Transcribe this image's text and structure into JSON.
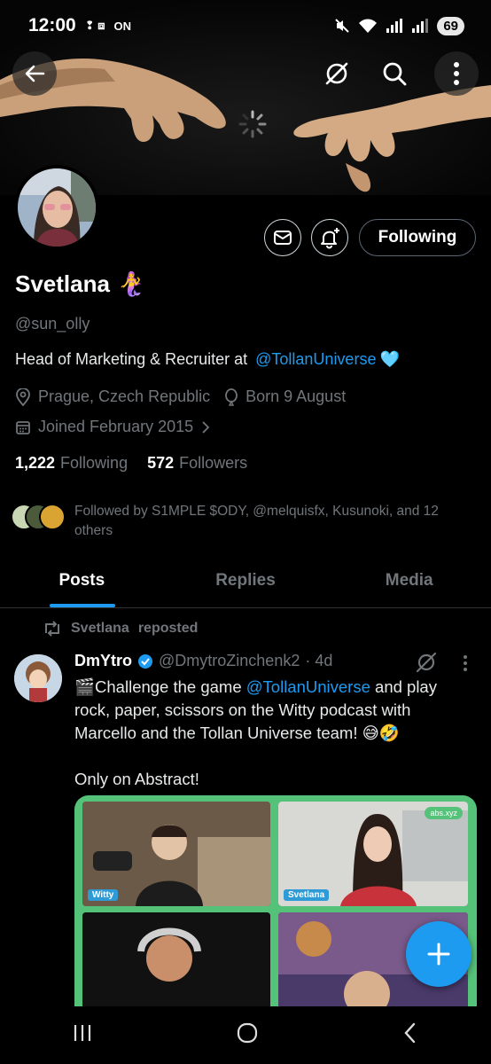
{
  "status_bar": {
    "time": "12:00",
    "indicators": "ON",
    "battery": "69"
  },
  "profile": {
    "name": "Svetlana",
    "name_emoji": "🧜‍♀️",
    "handle": "@sun_olly",
    "bio_prefix": "Head of Marketing & Recruiter at ",
    "bio_link": "@TollanUniverse",
    "bio_emoji": "🩵",
    "location": "Prague, Czech Republic",
    "birthday": "Born 9 August",
    "joined": "Joined February 2015",
    "following_count": "1,222",
    "following_label": "Following",
    "followers_count": "572",
    "followers_label": "Followers",
    "followed_by": "Followed by S1MPLE $ODY, @melquisfx, Kusunoki, and 12 others",
    "follow_button": "Following"
  },
  "tabs": [
    "Posts",
    "Replies",
    "Media"
  ],
  "post": {
    "repost_by": "Svetlana",
    "repost_label": "reposted",
    "author": "DmYtro",
    "author_handle": "@DmytroZinchenk2",
    "age": "· 4d",
    "text_lead": "🎬Challenge the game ",
    "text_link": "@TollanUniverse",
    "text_rest": " and play rock, paper, scissors on the Witty podcast with Marcello and the Tollan Universe team! 😅🤣\n\nOnly on Abstract!",
    "media_labels": [
      "Witty",
      "Svetlana"
    ],
    "media_badge": "abs.xyz"
  },
  "colors": {
    "accent": "#1d9bf0",
    "muted": "#71767b",
    "background": "#000000",
    "media_border": "#55c27a"
  },
  "icons": [
    "back-arrow-icon",
    "grok-icon",
    "search-icon",
    "more-icon",
    "message-icon",
    "bell-plus-icon",
    "location-icon",
    "balloon-icon",
    "calendar-icon",
    "chevron-right-icon",
    "repost-icon",
    "verified-icon",
    "plus-icon",
    "mute-icon"
  ]
}
